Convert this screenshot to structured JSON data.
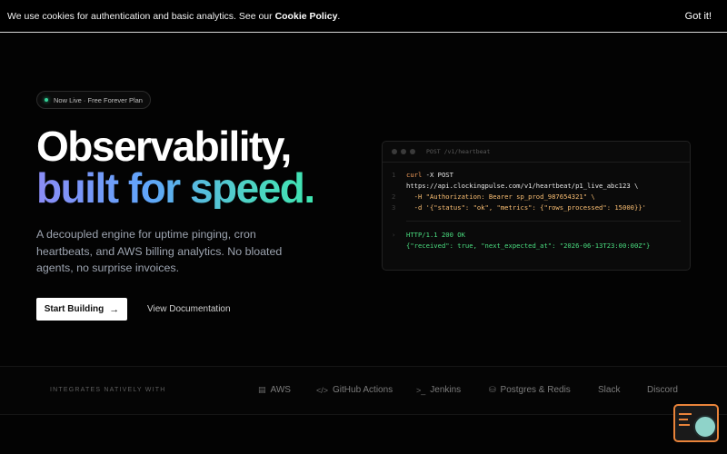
{
  "cookie": {
    "text": "We use cookies for authentication and basic analytics. See our ",
    "link": "Cookie Policy",
    "end": ".",
    "button": "Got it!"
  },
  "hero": {
    "badge": "Now Live · Free Forever Plan",
    "headline_line1": "Observability,",
    "headline_line2": "built for speed.",
    "subtext": "A decoupled engine for uptime pinging, cron heartbeats, and AWS billing analytics. No bloated agents, no surprise invoices.",
    "primary_button": "Start Building",
    "primary_icon": "arrow-right-icon",
    "secondary_button": "View Documentation"
  },
  "terminal": {
    "title": "POST /v1/heartbeat",
    "lines": [
      {
        "n": "1",
        "cmd": "curl",
        "rest": " -X POST"
      },
      {
        "n": "",
        "cmd": "",
        "rest": "https://api.clockingpulse.com/v1/heartbeat/p1_live_abc123 \\"
      },
      {
        "n": "2",
        "cmd": "",
        "rest": "  -H \"Authorization: Bearer sp_prod_987654321\" \\"
      },
      {
        "n": "3",
        "cmd": "",
        "rest": "  -d '{\"status\": \"ok\", \"metrics\": {\"rows_processed\": 15000}}'"
      }
    ],
    "response_status": "HTTP/1.1 200 OK",
    "response_body": "{\"received\": true, \"next_expected_at\": \"2026-06-13T23:00:00Z\"}"
  },
  "integrations": {
    "label": "INTEGRATES NATIVELY WITH",
    "items": [
      {
        "name": "AWS",
        "icon": "server-icon"
      },
      {
        "name": "GitHub Actions",
        "icon": "code-icon"
      },
      {
        "name": "Jenkins",
        "icon": "terminal-icon"
      },
      {
        "name": "Postgres & Redis",
        "icon": "database-icon"
      },
      {
        "name": "Slack",
        "icon": ""
      },
      {
        "name": "Discord",
        "icon": ""
      }
    ]
  },
  "colors": {
    "accent_green": "#34d399",
    "chat_border": "#e8833a"
  }
}
